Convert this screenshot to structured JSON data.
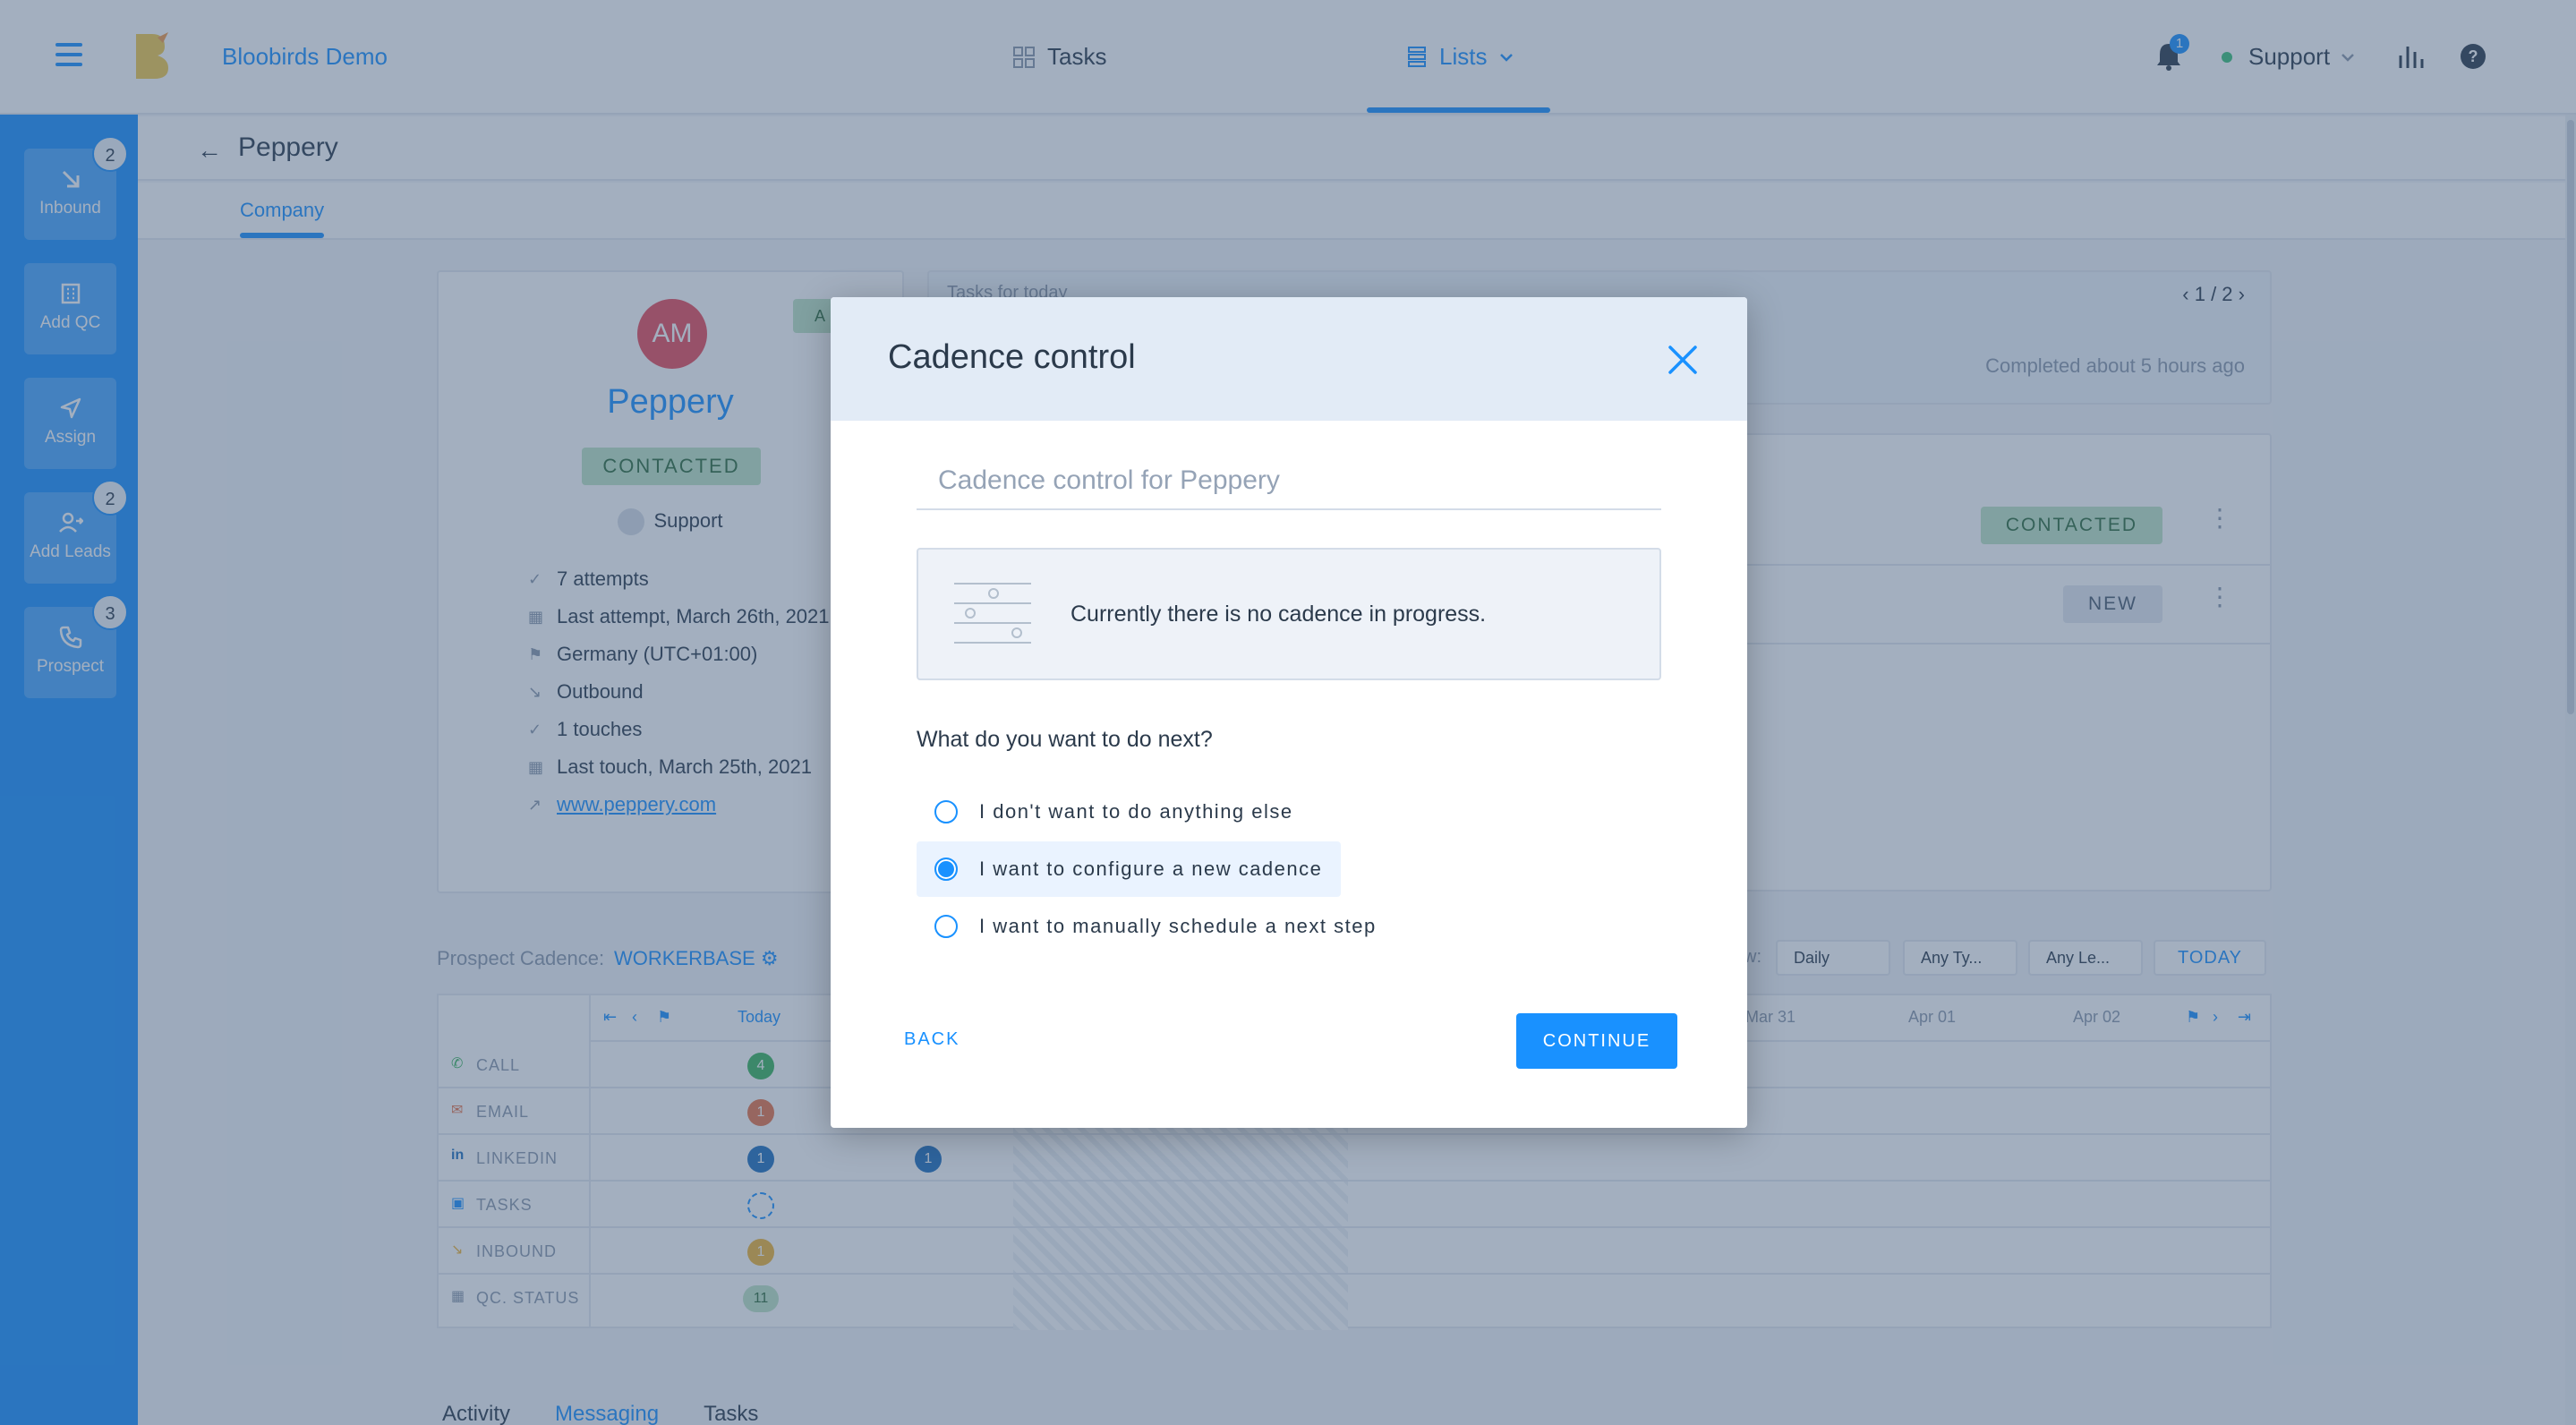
{
  "app": {
    "brand": "Bloobirds Demo",
    "nav": {
      "tasks": "Tasks",
      "lists": "Lists"
    },
    "notifications_count": "1",
    "user": "Support"
  },
  "sidebar": {
    "items": [
      {
        "label": "Inbound",
        "badge": "2"
      },
      {
        "label": "Add QC",
        "badge": ""
      },
      {
        "label": "Assign",
        "badge": ""
      },
      {
        "label": "Add Leads",
        "badge": "2"
      },
      {
        "label": "Prospect",
        "badge": "3"
      }
    ]
  },
  "page": {
    "title": "Peppery",
    "tab": "Company"
  },
  "company": {
    "initials": "AM",
    "name": "Peppery",
    "corner_badge": "A",
    "status": "CONTACTED",
    "owner": "Support",
    "info": [
      "7 attempts",
      "Last attempt, March 26th, 2021",
      "Germany (UTC+01:00)",
      "Outbound",
      "1 touches",
      "Last touch, March 25th, 2021"
    ],
    "website": "www.peppery.com"
  },
  "tasks_panel": {
    "header": "Tasks for today",
    "pager": "1 / 2",
    "completed": "Completed about 5 hours ago"
  },
  "leads": [
    {
      "status": "CONTACTED"
    },
    {
      "status": "NEW"
    }
  ],
  "cadence": {
    "label": "Prospect Cadence:",
    "name": "WORKERBASE",
    "filters": {
      "view_label": "w:",
      "view": "Daily",
      "type": "Any Ty...",
      "lead": "Any Le..."
    },
    "today_button": "TODAY",
    "dates": {
      "today": "Today",
      "mar31": "Mar 31",
      "apr01": "Apr 01",
      "apr02": "Apr 02"
    },
    "rows": [
      "CALL",
      "EMAIL",
      "LINKEDIN",
      "TASKS",
      "INBOUND",
      "QC. STATUS"
    ],
    "counts": {
      "call": "4",
      "email": "1",
      "linkedin": "1",
      "linkedin_next": "1",
      "inbound": "1",
      "qc_status": "11"
    }
  },
  "bottom_tabs": [
    "Activity",
    "Messaging",
    "Tasks"
  ],
  "modal": {
    "title": "Cadence control",
    "subtitle": "Cadence control for Peppery",
    "notice": "Currently there is no cadence in progress.",
    "question": "What do you want to do next?",
    "options": [
      {
        "label": "I don't want to do anything else",
        "selected": false
      },
      {
        "label": "I want to configure a new cadence",
        "selected": true
      },
      {
        "label": "I want to manually schedule a next step",
        "selected": false
      }
    ],
    "back": "BACK",
    "continue": "CONTINUE"
  },
  "colors": {
    "accent": "#1991ff",
    "contacted_bg": "#bfe4c5",
    "new_bg": "#e4e9f0",
    "call": "#3bb55c",
    "email": "#e8744a",
    "linkedin": "#1f6fbf",
    "inbound": "#f0b537",
    "qc": "#bfe4c5"
  }
}
